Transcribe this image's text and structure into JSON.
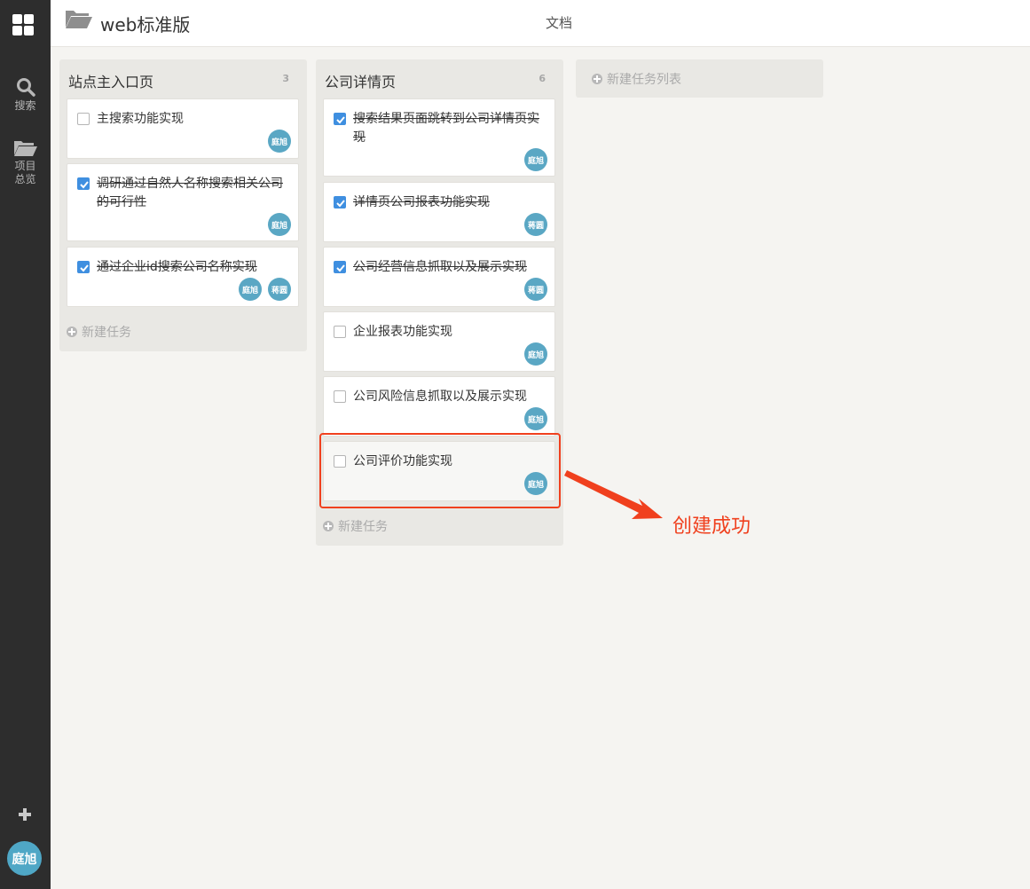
{
  "rail": {
    "search_label": "搜索",
    "overview_label": "项目总览",
    "avatar_text": "庭旭"
  },
  "header": {
    "project_title": "web标准版",
    "tab_docs": "文档"
  },
  "lists": [
    {
      "title": "站点主入口页",
      "count": "3",
      "add_task_label": "新建任务",
      "cards": [
        {
          "text": "主搜索功能实现",
          "done": false,
          "members": [
            "庭旭"
          ]
        },
        {
          "text": "调研通过自然人名称搜索相关公司的可行性",
          "done": true,
          "members": [
            "庭旭"
          ]
        },
        {
          "text": "通过企业id搜索公司名称实现",
          "done": true,
          "members": [
            "庭旭",
            "蒋圆"
          ]
        }
      ]
    },
    {
      "title": "公司详情页",
      "count": "6",
      "add_task_label": "新建任务",
      "cards": [
        {
          "text": "搜索结果页面跳转到公司详情页实现",
          "done": true,
          "members": [
            "庭旭"
          ]
        },
        {
          "text": "详情页公司报表功能实现",
          "done": true,
          "members": [
            "蒋圆"
          ]
        },
        {
          "text": "公司经营信息抓取以及展示实现",
          "done": true,
          "members": [
            "蒋圆"
          ]
        },
        {
          "text": "企业报表功能实现",
          "done": false,
          "members": [
            "庭旭"
          ]
        },
        {
          "text": "公司风险信息抓取以及展示实现",
          "done": false,
          "members": [
            "庭旭"
          ]
        },
        {
          "text": "公司评价功能实现",
          "done": false,
          "members": [
            "庭旭"
          ]
        }
      ]
    }
  ],
  "new_list_label": "新建任务列表",
  "annotation": {
    "text": "创建成功",
    "color": "#f0401e"
  },
  "colors": {
    "rail": "#2d2d2d",
    "member_avatar": "#5aa7c4",
    "checkbox_checked": "#3f8fe0"
  }
}
